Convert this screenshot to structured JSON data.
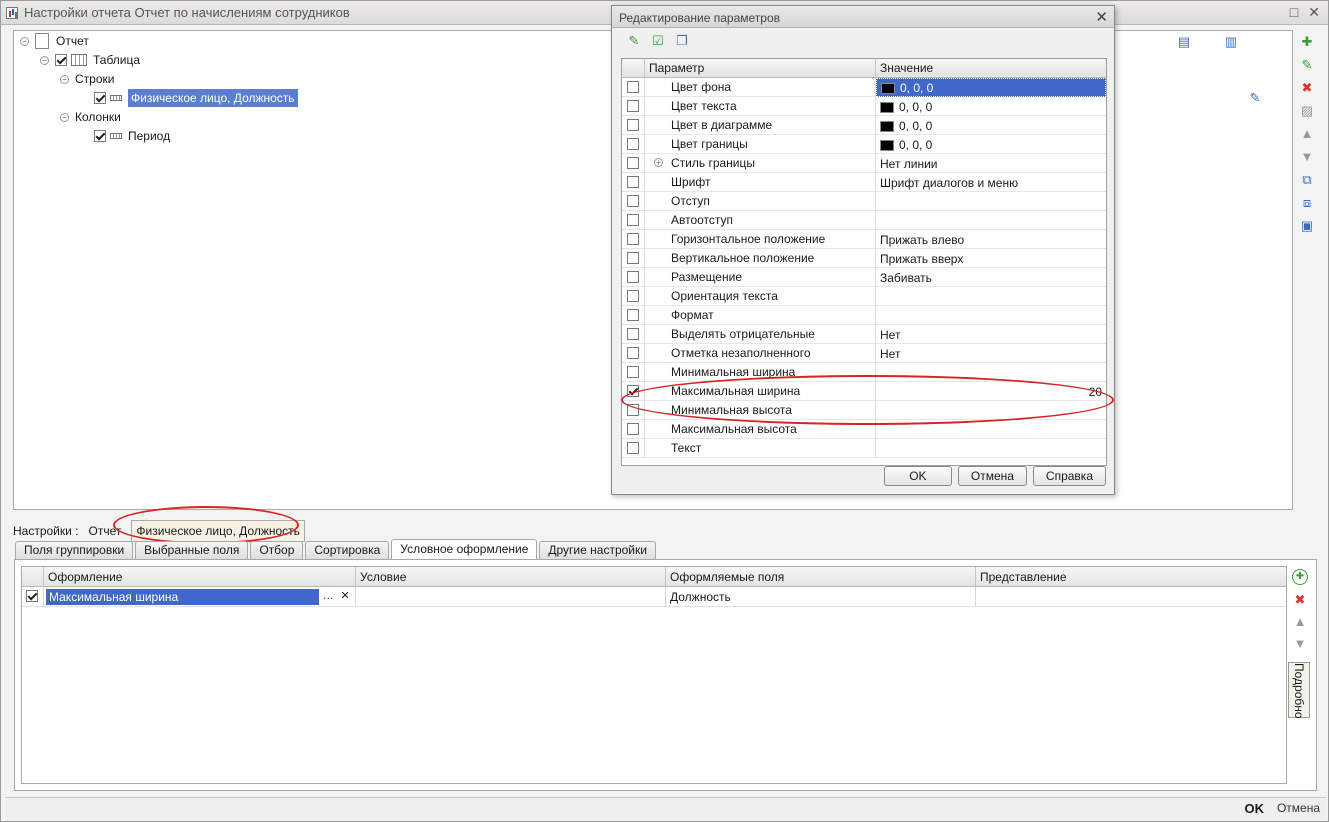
{
  "window": {
    "title": "Настройки отчета  Отчет по начислениям сотрудников",
    "controls": [
      "□",
      "✕"
    ]
  },
  "tree": [
    {
      "label": "Отчет"
    },
    {
      "label": "Таблица"
    },
    {
      "label": "Строки"
    },
    {
      "label": "Физическое лицо, Должность"
    },
    {
      "label": "Колонки"
    },
    {
      "label": "Период"
    }
  ],
  "settings": {
    "label": "Настройки :",
    "path_root": "Отчет",
    "path_item": "Физическое лицо, Должность"
  },
  "tabs": [
    "Поля группировки",
    "Выбранные поля",
    "Отбор",
    "Сортировка",
    "Условное оформление",
    "Другие настройки"
  ],
  "cond_grid": {
    "columns": [
      "Оформление",
      "Условие",
      "Оформляемые поля",
      "Представление"
    ],
    "rows": [
      {
        "checked": true,
        "design": "Максимальная ширина",
        "condition": "",
        "fields": "Должность",
        "presentation": ""
      }
    ]
  },
  "side_button": "Подробно",
  "status": {
    "ok": "OK",
    "cancel": "Отмена"
  },
  "dialog": {
    "title": "Редактирование параметров",
    "columns": [
      "Параметр",
      "Значение"
    ],
    "rows": [
      {
        "checked": false,
        "name": "Цвет фона",
        "value": "0, 0, 0",
        "swatch": "#000000"
      },
      {
        "checked": false,
        "name": "Цвет текста",
        "value": "0, 0, 0",
        "swatch": "#000000"
      },
      {
        "checked": false,
        "name": "Цвет в диаграмме",
        "value": "0, 0, 0",
        "swatch": "#000000"
      },
      {
        "checked": false,
        "name": "Цвет границы",
        "value": "0, 0, 0",
        "swatch": "#000000"
      },
      {
        "checked": false,
        "name": "Стиль границы",
        "value": "Нет линии",
        "expand": true
      },
      {
        "checked": false,
        "name": "Шрифт",
        "value": "Шрифт диалогов и меню"
      },
      {
        "checked": false,
        "name": "Отступ",
        "value": ""
      },
      {
        "checked": false,
        "name": "Автоотступ",
        "value": ""
      },
      {
        "checked": false,
        "name": "Горизонтальное положение",
        "value": "Прижать влево"
      },
      {
        "checked": false,
        "name": "Вертикальное положение",
        "value": "Прижать вверх"
      },
      {
        "checked": false,
        "name": "Размещение",
        "value": "Забивать"
      },
      {
        "checked": false,
        "name": "Ориентация текста",
        "value": ""
      },
      {
        "checked": false,
        "name": "Формат",
        "value": ""
      },
      {
        "checked": false,
        "name": "Выделять отрицательные",
        "value": "Нет"
      },
      {
        "checked": false,
        "name": "Отметка незаполненного",
        "value": "Нет"
      },
      {
        "checked": false,
        "name": "Минимальная ширина",
        "value": ""
      },
      {
        "checked": true,
        "name": "Максимальная ширина",
        "value": "20"
      },
      {
        "checked": false,
        "name": "Минимальная высота",
        "value": ""
      },
      {
        "checked": false,
        "name": "Максимальная высота",
        "value": ""
      },
      {
        "checked": false,
        "name": "Текст",
        "value": ""
      }
    ],
    "buttons": {
      "ok": "OK",
      "cancel": "Отмена",
      "help": "Справка"
    }
  },
  "colors": {
    "selection": "#3f68c9",
    "highlight_oval": "#d42424"
  }
}
